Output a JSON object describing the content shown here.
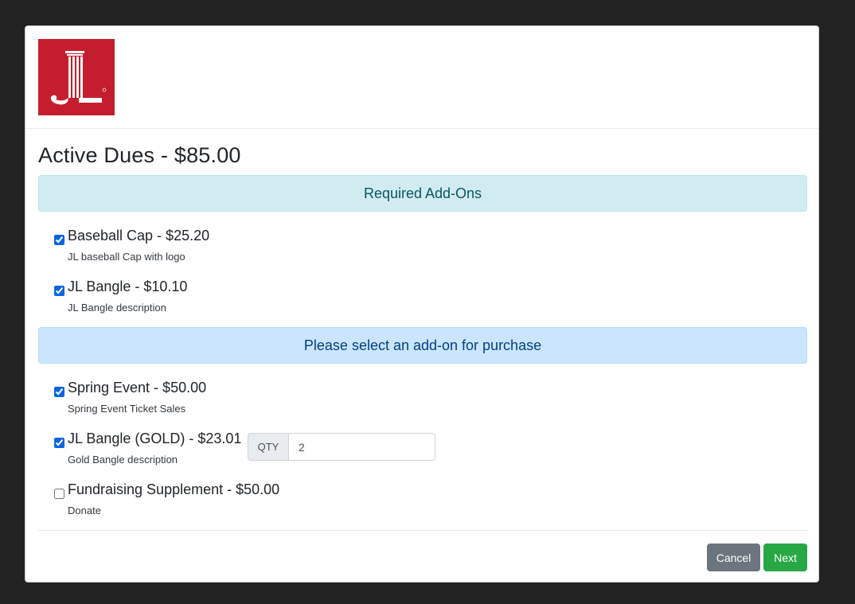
{
  "header": {
    "logo_text": "JL"
  },
  "title": "Active Dues - $85.00",
  "sections": {
    "required": {
      "label": "Required Add-Ons"
    },
    "optional": {
      "label": "Please select an add-on for purchase"
    }
  },
  "items": [
    {
      "name": "Baseball Cap - $25.20",
      "desc": "JL baseball Cap with logo",
      "checked": true
    },
    {
      "name": "JL Bangle - $10.10",
      "desc": "JL Bangle description",
      "checked": true
    },
    {
      "name": "Spring Event - $50.00",
      "desc": "Spring Event Ticket Sales",
      "checked": true
    },
    {
      "name": "JL Bangle (GOLD) - $23.01",
      "desc": "Gold Bangle description",
      "checked": true
    },
    {
      "name": "Fundraising Supplement - $50.00",
      "desc": "Donate",
      "checked": false
    }
  ],
  "qty": {
    "label": "QTY",
    "value": "2"
  },
  "footer": {
    "cancel_label": "Cancel",
    "next_label": "Next"
  },
  "colors": {
    "logo_red": "#c41e2e",
    "backdrop": "#222222"
  }
}
